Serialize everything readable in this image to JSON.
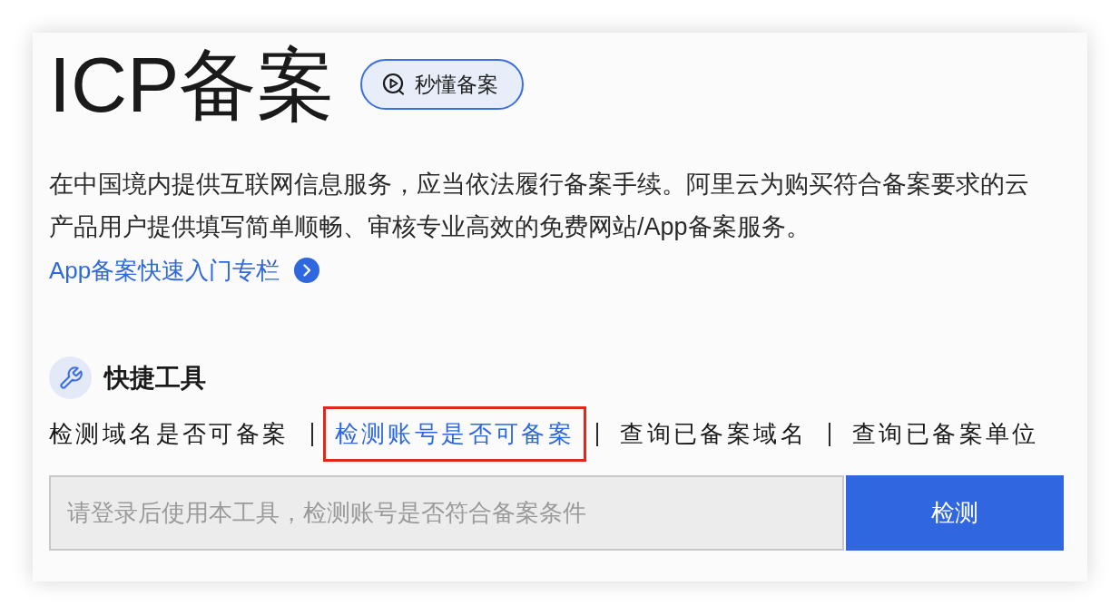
{
  "title": "ICP备案",
  "video_button": {
    "label": "秒懂备案"
  },
  "description": "在中国境内提供互联网信息服务，应当依法履行备案手续。阿里云为购买符合备案要求的云产品用户提供填写简单顺畅、审核专业高效的免费网站/App备案服务。",
  "guide_link": {
    "label": "App备案快速入门专栏"
  },
  "quick_tools": {
    "heading": "快捷工具",
    "tabs": [
      {
        "label": "检测域名是否可备案",
        "selected": false,
        "highlighted": false
      },
      {
        "label": "检测账号是否可备案",
        "selected": true,
        "highlighted": true
      },
      {
        "label": "查询已备案域名",
        "selected": false,
        "highlighted": false
      },
      {
        "label": "查询已备案单位",
        "selected": false,
        "highlighted": false
      }
    ],
    "search": {
      "placeholder": "请登录后使用本工具，检测账号是否符合备案条件"
    },
    "submit_button": {
      "label": "检测"
    }
  }
}
